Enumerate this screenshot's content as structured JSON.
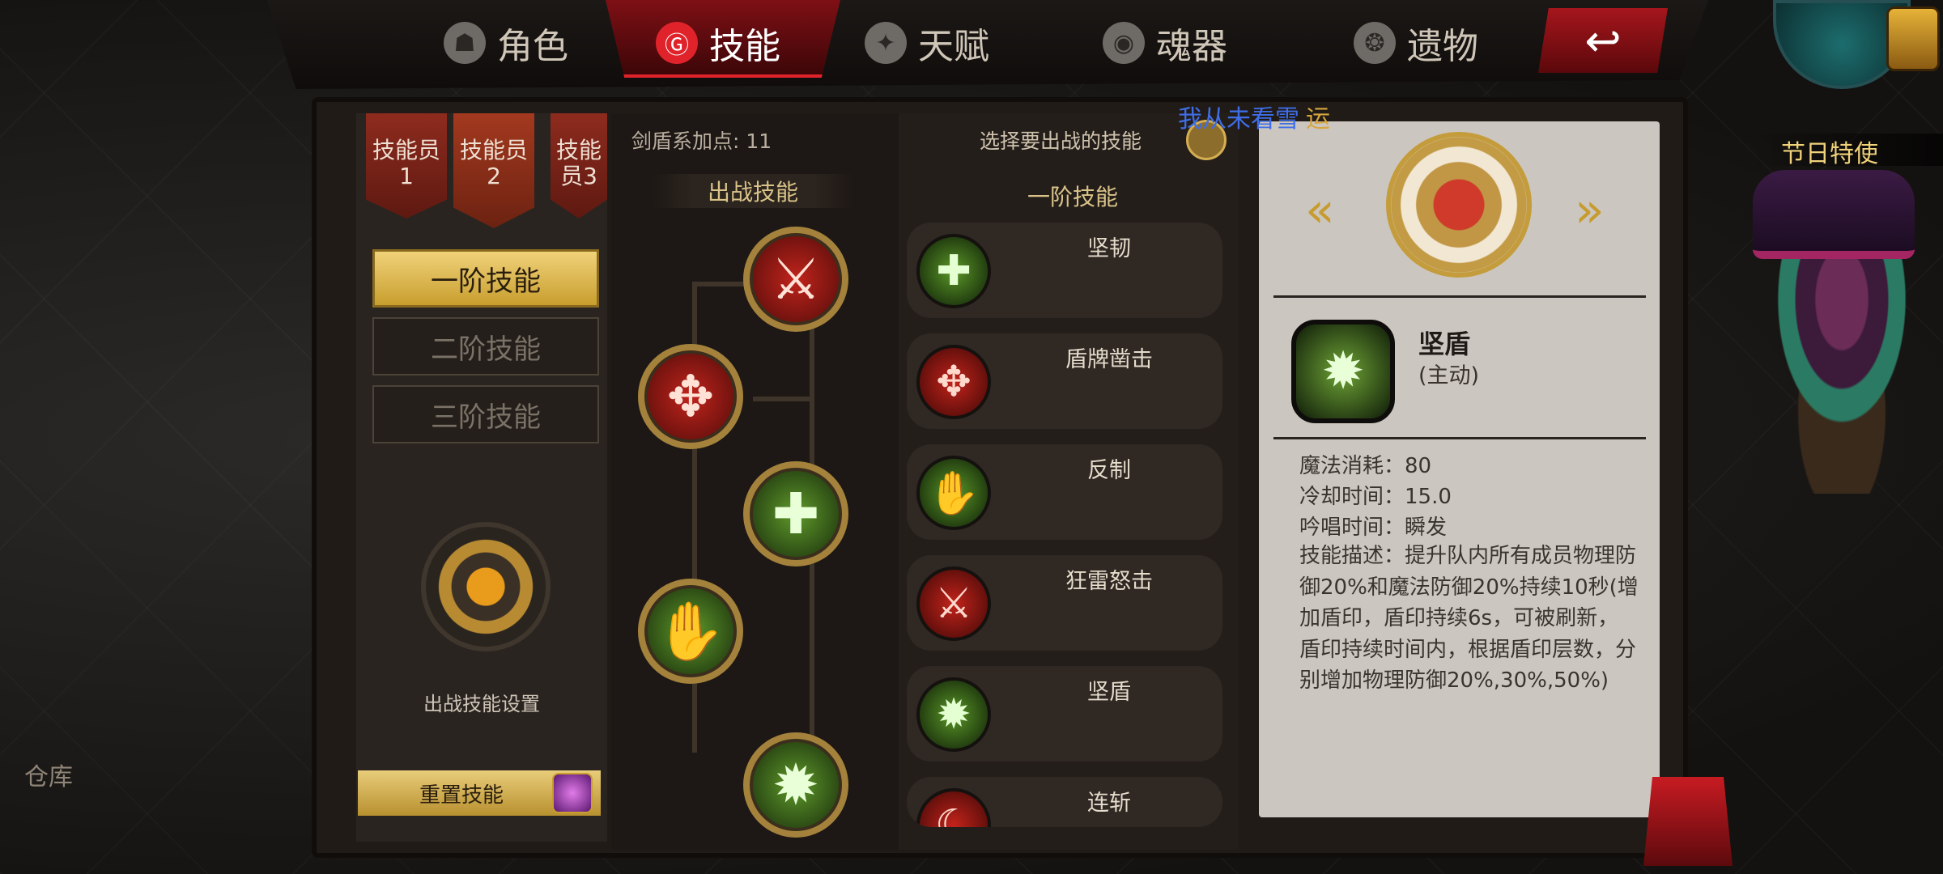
{
  "topnav": {
    "tabs": [
      {
        "label": "角色",
        "icon": "helmet-icon",
        "active": false
      },
      {
        "label": "技能",
        "icon": "skill-icon",
        "active": true
      },
      {
        "label": "天赋",
        "icon": "talent-icon",
        "active": false
      },
      {
        "label": "魂器",
        "icon": "soul-icon",
        "active": false
      },
      {
        "label": "遗物",
        "icon": "relic-icon",
        "active": false
      }
    ],
    "back_icon": "↩"
  },
  "colors": {
    "accent_red": "#e0232b",
    "gold": "#d9c389",
    "green_skill": "#5f9a2a"
  },
  "left": {
    "members": [
      "技能员1",
      "技能员2",
      "技能员3"
    ],
    "tiers": [
      "一阶技能",
      "二阶技能",
      "三阶技能"
    ],
    "battle_setting": "出战技能设置",
    "reset": "重置技能"
  },
  "tree": {
    "points_label": "剑盾系加点: 11",
    "header": "出战技能",
    "nodes": [
      {
        "icon": "⚔",
        "tone": "red"
      },
      {
        "icon": "✥",
        "tone": "red"
      },
      {
        "icon": "✚",
        "tone": "green"
      },
      {
        "icon": "✋",
        "tone": "green"
      },
      {
        "icon": "✹",
        "tone": "green"
      }
    ]
  },
  "list": {
    "choose_label": "选择要出战的技能",
    "tier_header": "一阶技能",
    "skills": [
      {
        "name": "坚韧",
        "icon": "✚",
        "tone": "green"
      },
      {
        "name": "盾牌凿击",
        "icon": "✥",
        "tone": "red"
      },
      {
        "name": "反制",
        "icon": "✋",
        "tone": "green"
      },
      {
        "name": "狂雷怒击",
        "icon": "⚔",
        "tone": "red"
      },
      {
        "name": "坚盾",
        "icon": "✹",
        "tone": "green"
      },
      {
        "name": "连斩",
        "icon": "☾",
        "tone": "red"
      }
    ]
  },
  "detail": {
    "player_name": "我从未看雪",
    "player_suffix": "运",
    "prev": "«",
    "next": "»",
    "skill_name": "坚盾",
    "skill_type": "(主动)",
    "mana": "魔法消耗：80",
    "cooldown": "冷却时间：15.0",
    "cast": "吟唱时间：瞬发",
    "description": "技能描述：提升队内所有成员物理防御20%和魔法防御20%持续10秒(增加盾印，盾印持续6s，可被刷新，盾印持续时间内，根据盾印层数，分别增加物理防御20%,30%,50%)"
  },
  "side": {
    "festival": "节日特使",
    "storage": "仓库"
  }
}
